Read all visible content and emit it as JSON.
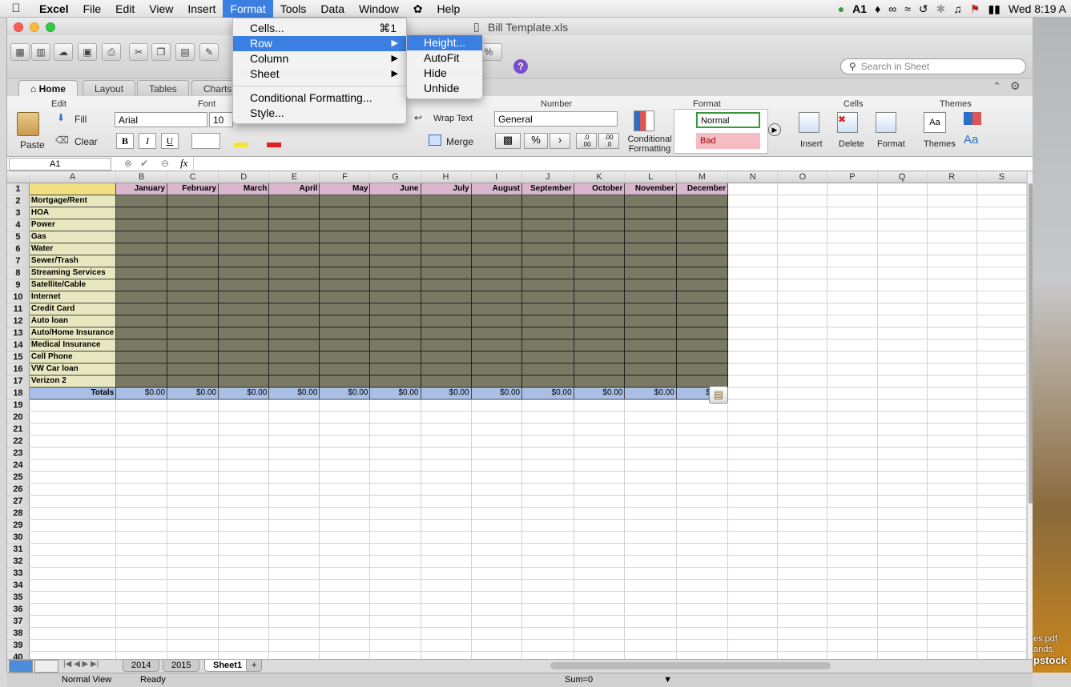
{
  "menubar": {
    "apple": "",
    "app": "Excel",
    "items": [
      "File",
      "Edit",
      "View",
      "Insert",
      "Format",
      "Tools",
      "Data",
      "Window",
      "Help"
    ],
    "active": "Format",
    "status_icons": [
      "evernote-icon",
      "adobe-icon",
      "notification-icon",
      "creative-cloud-icon",
      "wifi-icon",
      "time-machine-icon",
      "bluetooth-icon",
      "volume-icon",
      "flag-icon",
      "battery-icon"
    ],
    "adobe_count": "1",
    "clock": "Wed 8:19 A"
  },
  "window": {
    "title": "Bill Template.xls",
    "search_placeholder": "Search in Sheet"
  },
  "ribbon": {
    "tabs": [
      "Home",
      "Layout",
      "Tables",
      "Charts"
    ],
    "active_tab": "Home",
    "edit": {
      "group": "Edit",
      "paste": "Paste",
      "fill": "Fill",
      "clear": "Clear"
    },
    "font": {
      "group": "Font",
      "family": "Arial",
      "size": "10",
      "bold": "B",
      "italic": "I",
      "underline": "U"
    },
    "alignment": {
      "wrap": "Wrap Text",
      "merge": "Merge"
    },
    "number": {
      "group": "Number",
      "format": "General",
      "percent": "%",
      "comma": "›",
      "inc_dec": ".0\n.00",
      "dec_dec": ".00\n.0"
    },
    "format": {
      "group": "Format",
      "cond_line1": "Conditional",
      "cond_line2": "Formatting",
      "normal": "Normal",
      "bad": "Bad"
    },
    "cells": {
      "group": "Cells",
      "insert": "Insert",
      "delete": "Delete",
      "format": "Format"
    },
    "themes": {
      "group": "Themes",
      "themes": "Themes",
      "aa": "Aa"
    }
  },
  "formula_bar": {
    "name_box": "A1",
    "fx": "fx",
    "value": ""
  },
  "format_menu": {
    "items": [
      {
        "label": "Cells...",
        "shortcut": "⌘1",
        "submenu": false
      },
      {
        "label": "Row",
        "shortcut": "",
        "submenu": true
      },
      {
        "label": "Column",
        "shortcut": "",
        "submenu": true
      },
      {
        "label": "Sheet",
        "shortcut": "",
        "submenu": true
      },
      {
        "label": "Conditional Formatting...",
        "shortcut": "",
        "submenu": false
      },
      {
        "label": "Style...",
        "shortcut": "",
        "submenu": false
      }
    ],
    "highlighted": "Row"
  },
  "row_submenu": {
    "items": [
      "Height...",
      "AutoFit",
      "Hide",
      "Unhide"
    ],
    "highlighted": "Height..."
  },
  "sheet": {
    "columns": [
      "A",
      "B",
      "C",
      "D",
      "E",
      "F",
      "G",
      "H",
      "I",
      "J",
      "K",
      "L",
      "M",
      "N",
      "O",
      "P",
      "Q",
      "R",
      "S"
    ],
    "months": [
      "January",
      "February",
      "March",
      "April",
      "May",
      "June",
      "July",
      "August",
      "September",
      "October",
      "November",
      "December"
    ],
    "labels": [
      "Mortgage/Rent",
      "HOA",
      "Power",
      "Gas",
      "Water",
      "Sewer/Trash",
      "Streaming Services",
      "Satellite/Cable",
      "Internet",
      "Credit Card",
      "Auto loan",
      "Auto/Home Insurance",
      "Medical Insurance",
      "Cell Phone",
      "VW Car loan",
      "Verizon 2"
    ],
    "totals_label": "Totals",
    "totals": [
      "$0.00",
      "$0.00",
      "$0.00",
      "$0.00",
      "$0.00",
      "$0.00",
      "$0.00",
      "$0.00",
      "$0.00",
      "$0.00",
      "$0.00",
      "$0.00"
    ],
    "row_count": 40
  },
  "sheet_tabs": {
    "tabs": [
      "2014",
      "2015",
      "Sheet1"
    ],
    "active": "Sheet1",
    "add": "+"
  },
  "status": {
    "view": "Normal View",
    "state": "Ready",
    "sum": "Sum=0"
  },
  "desktop": {
    "labels": [
      "es.pdf",
      "ands,",
      "pstock"
    ]
  }
}
